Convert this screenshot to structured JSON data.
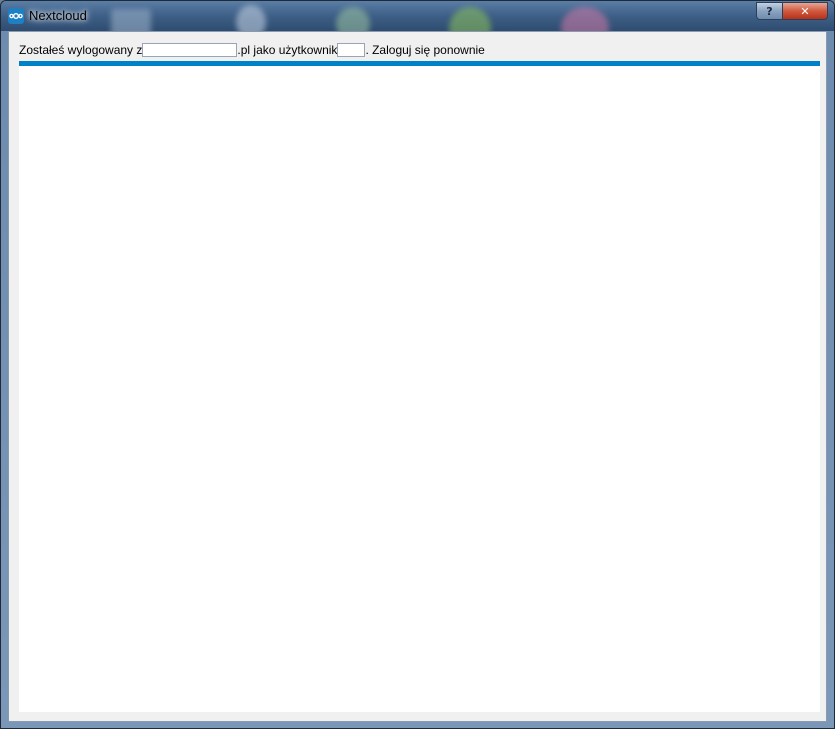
{
  "window": {
    "title": "Nextcloud",
    "icon": "nextcloud-logo-icon",
    "help_label": "?",
    "close_label": "✕"
  },
  "message": {
    "prefix": "Zostałeś wylogowany z ",
    "host_value": "",
    "middle": ".pl jako użytkownik",
    "user_value": "",
    "suffix": ". Zaloguj się ponownie"
  },
  "colors": {
    "accent_bar": "#0082c9",
    "close_button": "#c73d22"
  }
}
